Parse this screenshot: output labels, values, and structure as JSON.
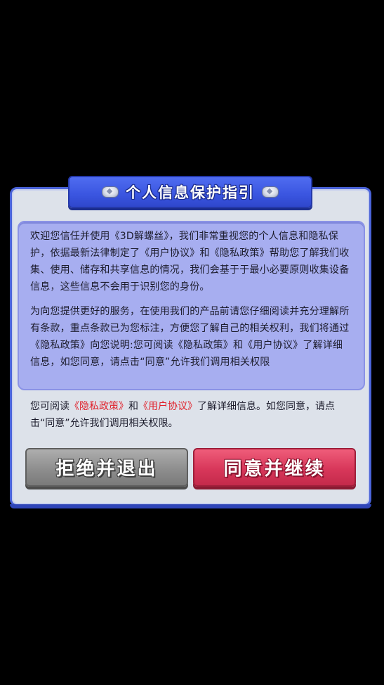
{
  "dialog": {
    "title": "个人信息保护指引",
    "paragraphs": [
      "欢迎您信任并使用《3D解螺丝》，我们非常重视您的个人信息和隐私保护，依据最新法律制定了《用户协议》和《隐私政策》帮助您了解我们收集、使用、储存和共享信息的情况，我们会基于于最小必要原则收集设备信息，这些信息不会用于识别您的身份。",
      "为向您提供更好的服务，在使用我们的产品前请您仔细阅读并充分理解所有条款，重点条款已为您标注，方便您了解自己的相关权利，我们将通过《隐私政策》向您说明:您可阅读《隐私政策》和《用户协议》了解详细信息，如您同意，请点击“同意”允许我们调用相关权限"
    ],
    "note": {
      "prefix": "您可阅读",
      "privacy_link": "《隐私政策》",
      "and": "和",
      "agreement_link": "《用户协议》",
      "suffix": "了解详细信息。如您同意，请点击“同意”允许我们调用相关权限。"
    },
    "buttons": {
      "reject": "拒绝并退出",
      "agree": "同意并继续"
    }
  },
  "colors": {
    "background": "#000000",
    "frame": "#4a63d8",
    "info_box": "#a7aef0",
    "link": "#e0202a",
    "reject_button": "#8e8e8e",
    "agree_button": "#d8375a"
  }
}
